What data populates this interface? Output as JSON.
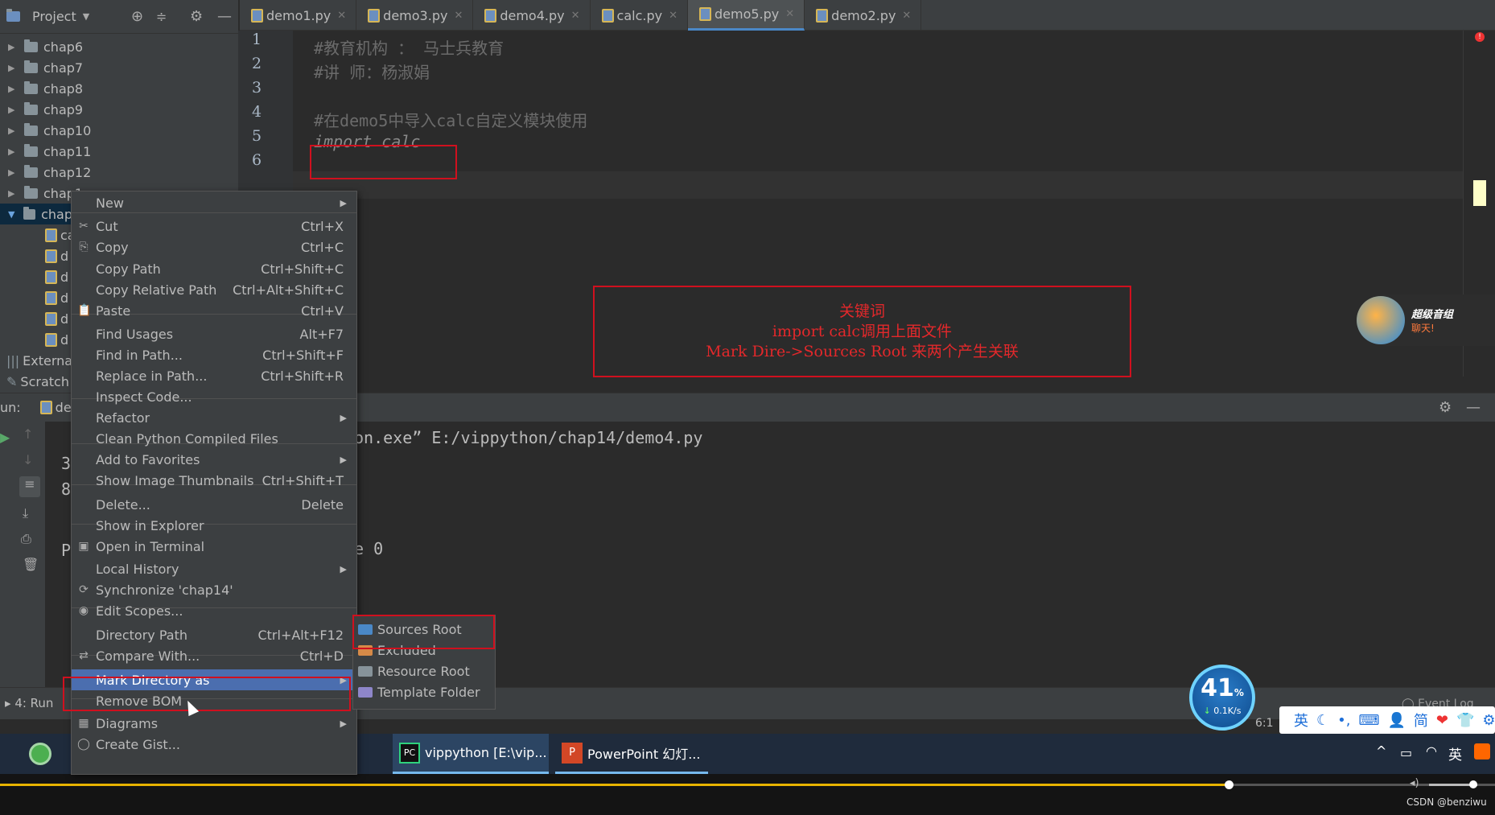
{
  "project": {
    "title": "Project",
    "tree": [
      {
        "label": "chap6",
        "expanded": false
      },
      {
        "label": "chap7",
        "expanded": false
      },
      {
        "label": "chap8",
        "expanded": false
      },
      {
        "label": "chap9",
        "expanded": false
      },
      {
        "label": "chap10",
        "expanded": false
      },
      {
        "label": "chap11",
        "expanded": false
      },
      {
        "label": "chap12",
        "expanded": false
      },
      {
        "label": "chap1",
        "expanded": false
      },
      {
        "label": "chap",
        "expanded": true
      }
    ],
    "children": [
      "ca",
      "d",
      "d",
      "d",
      "d",
      "d"
    ],
    "external": "External",
    "scratches": "Scratch"
  },
  "tabs": [
    {
      "label": "demo1.py",
      "active": false
    },
    {
      "label": "demo3.py",
      "active": false
    },
    {
      "label": "demo4.py",
      "active": false
    },
    {
      "label": "calc.py",
      "active": false
    },
    {
      "label": "demo5.py",
      "active": true
    },
    {
      "label": "demo2.py",
      "active": false
    }
  ],
  "editor": {
    "line_numbers": [
      "1",
      "2",
      "3",
      "4",
      "5",
      "6"
    ],
    "lines": [
      "#教育机构 ： 马士兵教育",
      "#讲      师：杨淑娟",
      "",
      "#在demo5中导入calc自定义模块使用",
      "import calc",
      ""
    ]
  },
  "annotation": {
    "line1": "关键词",
    "line2": "import calc调用上面文件",
    "line3": "Mark Dire->Sources Root 来两个产生关联"
  },
  "run": {
    "label": "un:",
    "tab": "de",
    "console_line1": "on.exe” E:/vippython/chap14/demo4.py",
    "console_line2": "e 0",
    "side_chars": [
      "3",
      "8",
      "P"
    ]
  },
  "context_menu": {
    "items": [
      {
        "label": "New",
        "shortcut": "",
        "submenu": true,
        "icon": ""
      },
      {
        "label": "Cut",
        "shortcut": "Ctrl+X",
        "submenu": false,
        "icon": "scissors-icon"
      },
      {
        "label": "Copy",
        "shortcut": "Ctrl+C",
        "submenu": false,
        "icon": "copy-icon"
      },
      {
        "label": "Copy Path",
        "shortcut": "Ctrl+Shift+C",
        "submenu": false,
        "icon": ""
      },
      {
        "label": "Copy Relative Path",
        "shortcut": "Ctrl+Alt+Shift+C",
        "submenu": false,
        "icon": ""
      },
      {
        "label": "Paste",
        "shortcut": "Ctrl+V",
        "submenu": false,
        "icon": "paste-icon"
      },
      {
        "label": "Find Usages",
        "shortcut": "Alt+F7",
        "submenu": false,
        "icon": ""
      },
      {
        "label": "Find in Path...",
        "shortcut": "Ctrl+Shift+F",
        "submenu": false,
        "icon": ""
      },
      {
        "label": "Replace in Path...",
        "shortcut": "Ctrl+Shift+R",
        "submenu": false,
        "icon": ""
      },
      {
        "label": "Inspect Code...",
        "shortcut": "",
        "submenu": false,
        "icon": ""
      },
      {
        "label": "Refactor",
        "shortcut": "",
        "submenu": true,
        "icon": ""
      },
      {
        "label": "Clean Python Compiled Files",
        "shortcut": "",
        "submenu": false,
        "icon": ""
      },
      {
        "label": "Add to Favorites",
        "shortcut": "",
        "submenu": true,
        "icon": ""
      },
      {
        "label": "Show Image Thumbnails",
        "shortcut": "Ctrl+Shift+T",
        "submenu": false,
        "icon": ""
      },
      {
        "label": "Delete...",
        "shortcut": "Delete",
        "submenu": false,
        "icon": ""
      },
      {
        "label": "Show in Explorer",
        "shortcut": "",
        "submenu": false,
        "icon": ""
      },
      {
        "label": "Open in Terminal",
        "shortcut": "",
        "submenu": false,
        "icon": "terminal-icon"
      },
      {
        "label": "Local History",
        "shortcut": "",
        "submenu": true,
        "icon": ""
      },
      {
        "label": "Synchronize 'chap14'",
        "shortcut": "",
        "submenu": false,
        "icon": "sync-icon"
      },
      {
        "label": "Edit Scopes...",
        "shortcut": "",
        "submenu": false,
        "icon": "scope-icon"
      },
      {
        "label": "Directory Path",
        "shortcut": "Ctrl+Alt+F12",
        "submenu": false,
        "icon": ""
      },
      {
        "label": "Compare With...",
        "shortcut": "Ctrl+D",
        "submenu": false,
        "icon": "compare-icon"
      },
      {
        "label": "Mark Directory as",
        "shortcut": "",
        "submenu": true,
        "icon": ""
      },
      {
        "label": "Remove BOM",
        "shortcut": "",
        "submenu": false,
        "icon": ""
      },
      {
        "label": "Diagrams",
        "shortcut": "",
        "submenu": true,
        "icon": "diagram-icon"
      },
      {
        "label": "Create Gist...",
        "shortcut": "",
        "submenu": false,
        "icon": "github-icon"
      }
    ]
  },
  "submenu": {
    "items": [
      {
        "label": "Sources Root",
        "color": "#4a88c7"
      },
      {
        "label": "Excluded",
        "color": "#d68a48"
      },
      {
        "label": "Resource Root",
        "color": "#87939a"
      },
      {
        "label": "Template Folder",
        "color": "#8e86c9"
      }
    ]
  },
  "status": {
    "run_tab": "4: Run",
    "event_log": "Event Log",
    "position": "6:1"
  },
  "speed_widget": {
    "percent": "41",
    "unit": "%",
    "rate": "0.1K/s"
  },
  "taskbar": {
    "apps": [
      {
        "label": "vippython [E:\\vip..."
      },
      {
        "label": "PowerPoint 幻灯..."
      }
    ],
    "tray_lang": "英"
  },
  "ime": {
    "items": [
      "英",
      "简"
    ]
  },
  "bubble": {
    "line1": "超级音组",
    "line2": "聊天!"
  },
  "watermark": "CSDN @benziwu"
}
